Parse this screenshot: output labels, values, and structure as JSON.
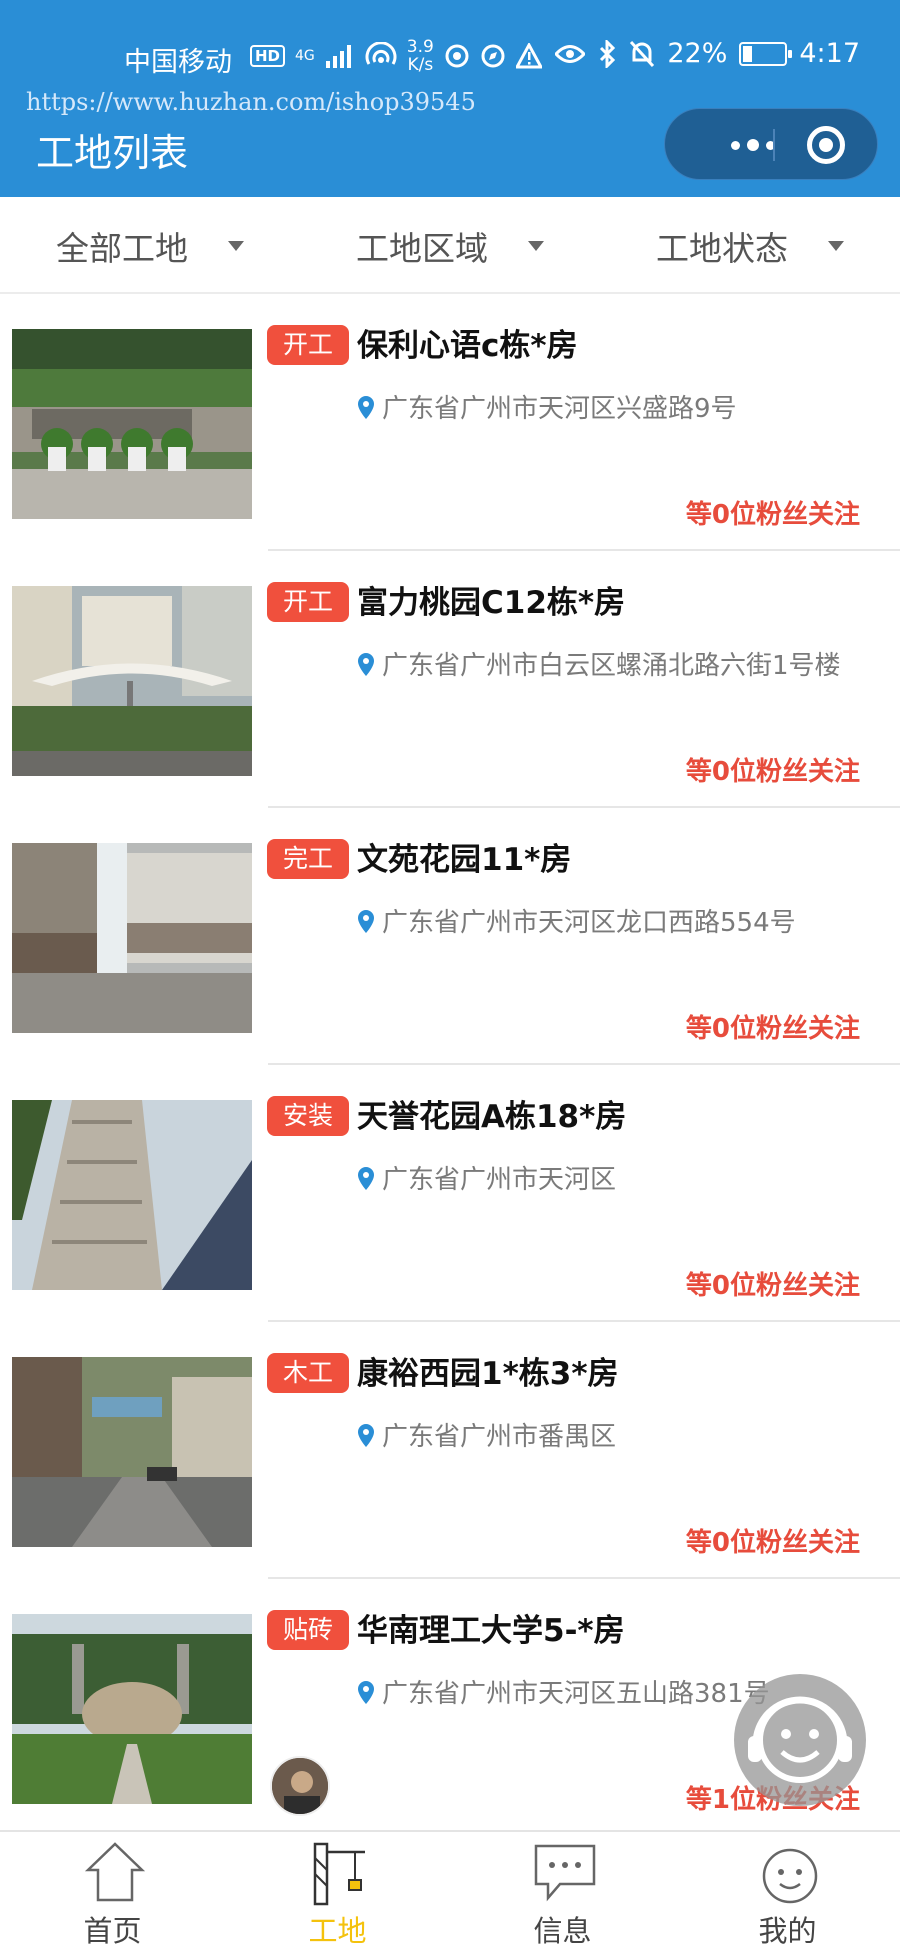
{
  "status_bar": {
    "carrier": "中国移动",
    "hd": "HD",
    "network": "4G",
    "speed_value": "3.9",
    "speed_unit": "K/s",
    "battery": "22%",
    "battery_level": 0.22,
    "time": "4:17"
  },
  "watermark": "https://www.huzhan.com/ishop39545",
  "header": {
    "title": "工地列表"
  },
  "filters": [
    "全部工地",
    "工地区域",
    "工地状态"
  ],
  "sites": [
    {
      "tag": "开工",
      "name": "保利心语c栋*房",
      "address": "广东省广州市天河区兴盛路9号",
      "fans": "等0位粉丝关注"
    },
    {
      "tag": "开工",
      "name": "富力桃园C12栋*房",
      "address": "广东省广州市白云区螺涌北路六街1号楼",
      "fans": "等0位粉丝关注"
    },
    {
      "tag": "完工",
      "name": "文苑花园11*房",
      "address": "广东省广州市天河区龙口西路554号",
      "fans": "等0位粉丝关注"
    },
    {
      "tag": "安装",
      "name": "天誉花园A栋18*房",
      "address": "广东省广州市天河区",
      "fans": "等0位粉丝关注"
    },
    {
      "tag": "木工",
      "name": "康裕西园1*栋3*房",
      "address": "广东省广州市番禺区",
      "fans": "等0位粉丝关注"
    },
    {
      "tag": "贴砖",
      "name": "华南理工大学5-*房",
      "address": "广东省广州市天河区五山路381号",
      "fans": "等1位粉丝关注"
    }
  ],
  "tabs": [
    "首页",
    "工地",
    "信息",
    "我的"
  ],
  "colors": {
    "header": "#2a8ed6",
    "tag": "#f0503d",
    "fans": "#e74c3c",
    "active_tab": "#f4c20d"
  }
}
